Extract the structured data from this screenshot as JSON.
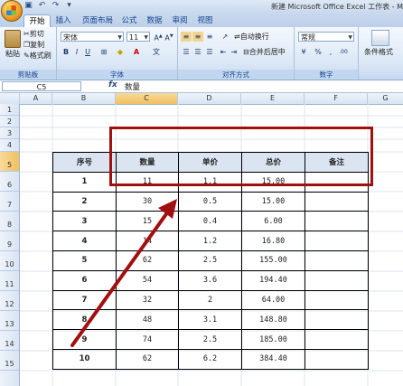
{
  "window": {
    "title": "新建 Microsoft Office Excel 工作表 - Mic"
  },
  "tabs": [
    "开始",
    "插入",
    "页面布局",
    "公式",
    "数据",
    "审阅",
    "视图"
  ],
  "ribbon": {
    "clipboard": {
      "paste": "粘贴",
      "cut": "剪切",
      "copy": "复制",
      "format_painter": "格式刷",
      "label": "剪贴板"
    },
    "font": {
      "name": "宋体",
      "size": "11",
      "label": "字体"
    },
    "alignment": {
      "wrap": "自动换行",
      "merge": "合并后居中",
      "label": "对齐方式"
    },
    "number": {
      "format": "常规",
      "label": "数字"
    },
    "styles": {
      "conditional": "条件格式"
    }
  },
  "formula_bar": {
    "cell": "C5",
    "fx": "fx",
    "value": "数量"
  },
  "columns": [
    "A",
    "B",
    "C",
    "D",
    "E",
    "F",
    "G"
  ],
  "rows": [
    "1",
    "2",
    "3",
    "4",
    "5",
    "6",
    "7",
    "8",
    "9",
    "10",
    "11",
    "12",
    "13",
    "14",
    "15"
  ],
  "table": {
    "headers": [
      "序号",
      "数量",
      "单价",
      "总价",
      "备注"
    ],
    "rows": [
      [
        "1",
        "11",
        "1.1",
        "15.00",
        ""
      ],
      [
        "2",
        "30",
        "0.5",
        "15.00",
        ""
      ],
      [
        "3",
        "15",
        "0.4",
        "6.00",
        ""
      ],
      [
        "4",
        "14",
        "1.2",
        "16.80",
        ""
      ],
      [
        "5",
        "62",
        "2.5",
        "155.00",
        ""
      ],
      [
        "6",
        "54",
        "3.6",
        "194.40",
        ""
      ],
      [
        "7",
        "32",
        "2",
        "64.00",
        ""
      ],
      [
        "8",
        "48",
        "3.1",
        "148.80",
        ""
      ],
      [
        "9",
        "74",
        "2.5",
        "185.00",
        ""
      ],
      [
        "10",
        "62",
        "6.2",
        "384.40",
        ""
      ]
    ]
  },
  "colors": {
    "annotation": "#a01010",
    "header_fill": "#dbe5f1",
    "ribbon": "#dbe7f6"
  }
}
